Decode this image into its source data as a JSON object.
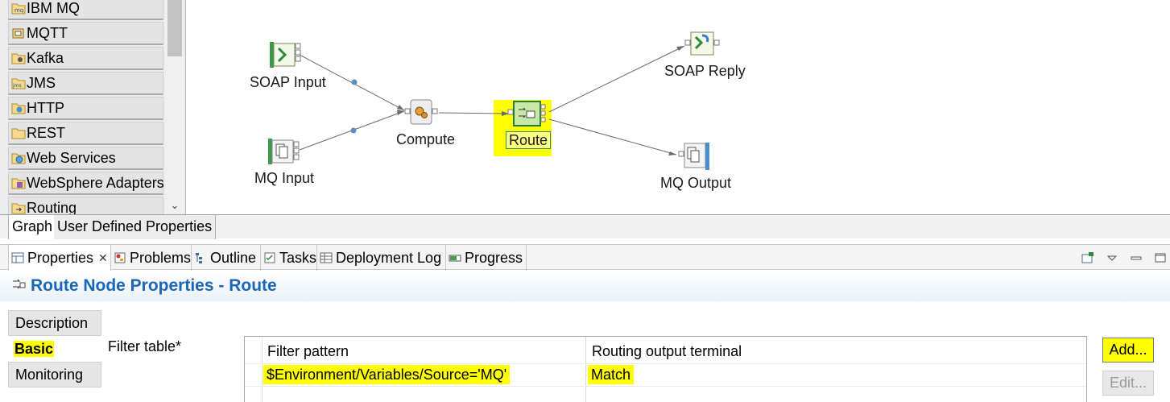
{
  "palette": {
    "items": [
      {
        "label": "IBM MQ",
        "icon": "mq-folder-icon"
      },
      {
        "label": "MQTT",
        "icon": "mqtt-icon"
      },
      {
        "label": "Kafka",
        "icon": "kafka-icon"
      },
      {
        "label": "JMS",
        "icon": "jms-folder-icon"
      },
      {
        "label": "HTTP",
        "icon": "http-folder-icon"
      },
      {
        "label": "REST",
        "icon": "rest-folder-icon"
      },
      {
        "label": "Web Services",
        "icon": "web-services-icon"
      },
      {
        "label": "WebSphere Adapters",
        "icon": "websphere-adapters-icon"
      },
      {
        "label": "Routing",
        "icon": "routing-icon"
      }
    ],
    "scroll_down_glyph": "⌄"
  },
  "flow": {
    "nodes": {
      "soap_input": "SOAP Input",
      "mq_input": "MQ Input",
      "compute": "Compute",
      "route": "Route",
      "soap_reply": "SOAP Reply",
      "mq_output": "MQ Output"
    },
    "highlight_color": "#ffff00"
  },
  "graph_tabs": [
    "Graph",
    "User Defined Properties"
  ],
  "view_tabs": [
    {
      "label": "Properties",
      "icon": "properties-icon",
      "active": true,
      "close": "✕"
    },
    {
      "label": "Problems",
      "icon": "problems-icon"
    },
    {
      "label": "Outline",
      "icon": "outline-icon"
    },
    {
      "label": "Tasks",
      "icon": "tasks-icon"
    },
    {
      "label": "Deployment Log",
      "icon": "deployment-log-icon"
    },
    {
      "label": "Progress",
      "icon": "progress-icon"
    }
  ],
  "properties": {
    "title": "Route Node Properties - Route",
    "title_color": "#1a66b8",
    "sections": [
      "Description",
      "Basic",
      "Monitoring"
    ],
    "active_section": "Basic",
    "filter_table_label": "Filter table*",
    "columns": [
      "Filter pattern",
      "Routing output terminal"
    ],
    "rows": [
      {
        "pattern": "$Environment/Variables/Source='MQ'",
        "terminal": "Match"
      }
    ],
    "buttons": {
      "add": "Add...",
      "edit": "Edit..."
    }
  }
}
